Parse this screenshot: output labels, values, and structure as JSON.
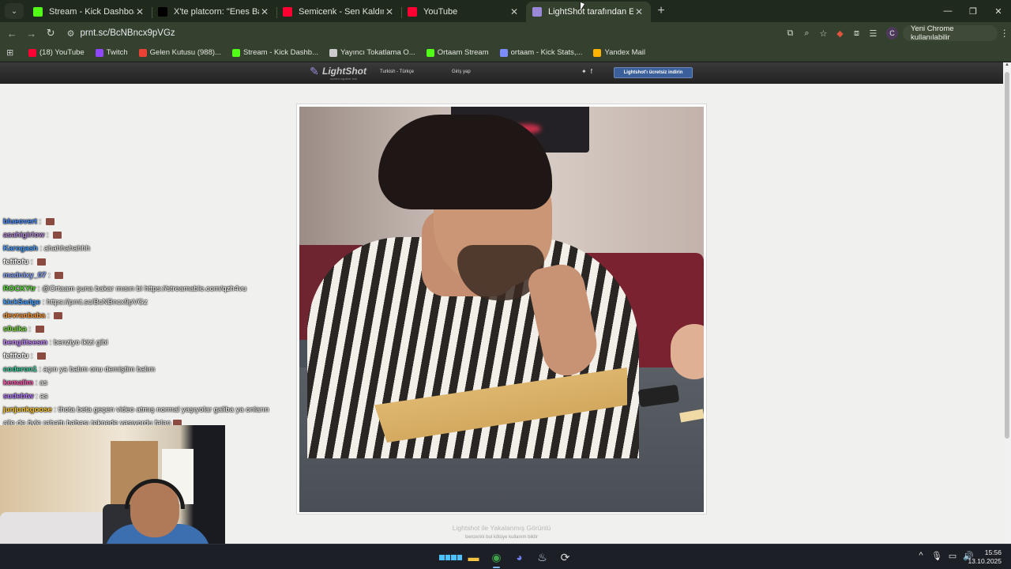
{
  "browser": {
    "tabs": [
      {
        "title": "Stream - Kick Dashboard",
        "favicon": "kick-icon",
        "color": "#53fc18",
        "active": false
      },
      {
        "title": "X'te platcorn: \"Enes Batur; wtcN",
        "favicon": "x-icon",
        "color": "#000000",
        "active": false
      },
      {
        "title": "Semicenk - Sen Kaldın (prod. b",
        "favicon": "youtube-icon",
        "color": "#ff0033",
        "active": false
      },
      {
        "title": "YouTube",
        "favicon": "youtube-icon",
        "color": "#ff0033",
        "active": false
      },
      {
        "title": "LightShot tarafından Ekran Görü",
        "favicon": "lightshot-icon",
        "color": "#9a88d8",
        "active": true
      }
    ],
    "url": "prnt.sc/BcNBncx9pVGz",
    "update_button": "Yeni Chrome kullanılabilir",
    "profile_initial": "C",
    "bookmarks": [
      {
        "label": "(18) YouTube",
        "icon": "youtube-icon",
        "color": "#ff0033"
      },
      {
        "label": "Twitch",
        "icon": "twitch-icon",
        "color": "#9146ff"
      },
      {
        "label": "Gelen Kutusu (988)...",
        "icon": "gmail-icon",
        "color": "#ea4335"
      },
      {
        "label": "Stream - Kick Dashb...",
        "icon": "kick-icon",
        "color": "#53fc18"
      },
      {
        "label": "Yayıncı Tokatlama O...",
        "icon": "globe-icon",
        "color": "#cccccc"
      },
      {
        "label": "Ortaam Stream",
        "icon": "kick-icon",
        "color": "#53fc18"
      },
      {
        "label": "ortaam - Kick Stats,...",
        "icon": "stats-icon",
        "color": "#7a8cff"
      },
      {
        "label": "Yandex Mail",
        "icon": "mail-icon",
        "color": "#ffb300"
      }
    ]
  },
  "lightshot": {
    "brand": "LightShot",
    "tagline": "screen capture tool",
    "language": "Turkish - Türkçe",
    "login": "Giriş yap",
    "download": "Lightshot'ı ücretsiz indirin",
    "caption": "Lightshot ile Yakalanmış Görüntü",
    "subcaption": "benzerini bul    kötüye kullanım bildir"
  },
  "chat": [
    {
      "user": "blueovert",
      "text": "",
      "color": "#4a8cff",
      "emote": true
    },
    {
      "user": "asahigirlow",
      "text": "",
      "color": "#b48ad8",
      "emote": true
    },
    {
      "user": "Karogash",
      "text": "ahahhahahhh",
      "color": "#4ca0ff",
      "emote": false
    },
    {
      "user": "fefifofu",
      "text": "",
      "color": "#ffffff",
      "emote": true
    },
    {
      "user": "madnixy_07",
      "text": "",
      "color": "#8aa8ff",
      "emote": true
    },
    {
      "user": "ROCKYtr",
      "text": "@Ortaam şuna bakar mısın bi https://streamable.com/qzh4vu",
      "color": "#5bdc3a",
      "emote": false
    },
    {
      "user": "kickSadge",
      "text": "https://prnt.sc/BcNBncx9pVGz",
      "color": "#4aa0ff",
      "emote": false
    },
    {
      "user": "devranbaba",
      "text": "",
      "color": "#ff9a3a",
      "emote": true
    },
    {
      "user": "s0ulka",
      "text": "",
      "color": "#7fe04a",
      "emote": true
    },
    {
      "user": "bengütsesm",
      "text": "benziyo ikizi gibi",
      "color": "#c98aff",
      "emote": false
    },
    {
      "user": "fefifofu",
      "text": "",
      "color": "#ffffff",
      "emote": true
    },
    {
      "user": "coderon1",
      "text": "açın ya balım onu demiştim balım",
      "color": "#3ad0a0",
      "emote": false
    },
    {
      "user": "kemalim",
      "text": "as",
      "color": "#ff5ab4",
      "emote": false
    },
    {
      "user": "sudebtw",
      "text": "as",
      "color": "#b47aff",
      "emote": false
    },
    {
      "user": "junjunkgoose",
      "text": "thota beta geçen video atmış normal yaşıyolar galiba ya onların",
      "color": "#ffcc33",
      "emote": false
    },
    {
      "user": "",
      "text": "aile de öyle rahattı babası teknede yaşıyordu falan",
      "color": "#ffffff",
      "emote": true
    }
  ],
  "taskbar": {
    "apps": [
      "start-icon",
      "file-explorer-icon",
      "chrome-icon",
      "discord-icon",
      "steam-icon",
      "app-icon"
    ],
    "time": "15:56",
    "date": "13.10.2025"
  }
}
